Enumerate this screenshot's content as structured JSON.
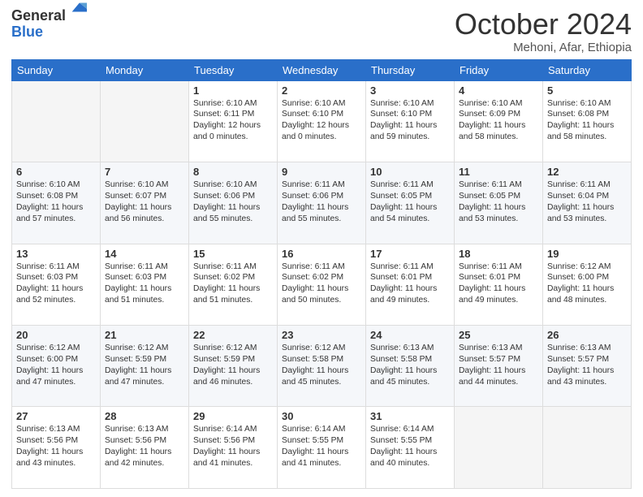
{
  "header": {
    "logo_general": "General",
    "logo_blue": "Blue",
    "month_title": "October 2024",
    "location": "Mehoni, Afar, Ethiopia"
  },
  "days_of_week": [
    "Sunday",
    "Monday",
    "Tuesday",
    "Wednesday",
    "Thursday",
    "Friday",
    "Saturday"
  ],
  "weeks": [
    [
      {
        "day": "",
        "info": ""
      },
      {
        "day": "",
        "info": ""
      },
      {
        "day": "1",
        "info": "Sunrise: 6:10 AM\nSunset: 6:11 PM\nDaylight: 12 hours\nand 0 minutes."
      },
      {
        "day": "2",
        "info": "Sunrise: 6:10 AM\nSunset: 6:10 PM\nDaylight: 12 hours\nand 0 minutes."
      },
      {
        "day": "3",
        "info": "Sunrise: 6:10 AM\nSunset: 6:10 PM\nDaylight: 11 hours\nand 59 minutes."
      },
      {
        "day": "4",
        "info": "Sunrise: 6:10 AM\nSunset: 6:09 PM\nDaylight: 11 hours\nand 58 minutes."
      },
      {
        "day": "5",
        "info": "Sunrise: 6:10 AM\nSunset: 6:08 PM\nDaylight: 11 hours\nand 58 minutes."
      }
    ],
    [
      {
        "day": "6",
        "info": "Sunrise: 6:10 AM\nSunset: 6:08 PM\nDaylight: 11 hours\nand 57 minutes."
      },
      {
        "day": "7",
        "info": "Sunrise: 6:10 AM\nSunset: 6:07 PM\nDaylight: 11 hours\nand 56 minutes."
      },
      {
        "day": "8",
        "info": "Sunrise: 6:10 AM\nSunset: 6:06 PM\nDaylight: 11 hours\nand 55 minutes."
      },
      {
        "day": "9",
        "info": "Sunrise: 6:11 AM\nSunset: 6:06 PM\nDaylight: 11 hours\nand 55 minutes."
      },
      {
        "day": "10",
        "info": "Sunrise: 6:11 AM\nSunset: 6:05 PM\nDaylight: 11 hours\nand 54 minutes."
      },
      {
        "day": "11",
        "info": "Sunrise: 6:11 AM\nSunset: 6:05 PM\nDaylight: 11 hours\nand 53 minutes."
      },
      {
        "day": "12",
        "info": "Sunrise: 6:11 AM\nSunset: 6:04 PM\nDaylight: 11 hours\nand 53 minutes."
      }
    ],
    [
      {
        "day": "13",
        "info": "Sunrise: 6:11 AM\nSunset: 6:03 PM\nDaylight: 11 hours\nand 52 minutes."
      },
      {
        "day": "14",
        "info": "Sunrise: 6:11 AM\nSunset: 6:03 PM\nDaylight: 11 hours\nand 51 minutes."
      },
      {
        "day": "15",
        "info": "Sunrise: 6:11 AM\nSunset: 6:02 PM\nDaylight: 11 hours\nand 51 minutes."
      },
      {
        "day": "16",
        "info": "Sunrise: 6:11 AM\nSunset: 6:02 PM\nDaylight: 11 hours\nand 50 minutes."
      },
      {
        "day": "17",
        "info": "Sunrise: 6:11 AM\nSunset: 6:01 PM\nDaylight: 11 hours\nand 49 minutes."
      },
      {
        "day": "18",
        "info": "Sunrise: 6:11 AM\nSunset: 6:01 PM\nDaylight: 11 hours\nand 49 minutes."
      },
      {
        "day": "19",
        "info": "Sunrise: 6:12 AM\nSunset: 6:00 PM\nDaylight: 11 hours\nand 48 minutes."
      }
    ],
    [
      {
        "day": "20",
        "info": "Sunrise: 6:12 AM\nSunset: 6:00 PM\nDaylight: 11 hours\nand 47 minutes."
      },
      {
        "day": "21",
        "info": "Sunrise: 6:12 AM\nSunset: 5:59 PM\nDaylight: 11 hours\nand 47 minutes."
      },
      {
        "day": "22",
        "info": "Sunrise: 6:12 AM\nSunset: 5:59 PM\nDaylight: 11 hours\nand 46 minutes."
      },
      {
        "day": "23",
        "info": "Sunrise: 6:12 AM\nSunset: 5:58 PM\nDaylight: 11 hours\nand 45 minutes."
      },
      {
        "day": "24",
        "info": "Sunrise: 6:13 AM\nSunset: 5:58 PM\nDaylight: 11 hours\nand 45 minutes."
      },
      {
        "day": "25",
        "info": "Sunrise: 6:13 AM\nSunset: 5:57 PM\nDaylight: 11 hours\nand 44 minutes."
      },
      {
        "day": "26",
        "info": "Sunrise: 6:13 AM\nSunset: 5:57 PM\nDaylight: 11 hours\nand 43 minutes."
      }
    ],
    [
      {
        "day": "27",
        "info": "Sunrise: 6:13 AM\nSunset: 5:56 PM\nDaylight: 11 hours\nand 43 minutes."
      },
      {
        "day": "28",
        "info": "Sunrise: 6:13 AM\nSunset: 5:56 PM\nDaylight: 11 hours\nand 42 minutes."
      },
      {
        "day": "29",
        "info": "Sunrise: 6:14 AM\nSunset: 5:56 PM\nDaylight: 11 hours\nand 41 minutes."
      },
      {
        "day": "30",
        "info": "Sunrise: 6:14 AM\nSunset: 5:55 PM\nDaylight: 11 hours\nand 41 minutes."
      },
      {
        "day": "31",
        "info": "Sunrise: 6:14 AM\nSunset: 5:55 PM\nDaylight: 11 hours\nand 40 minutes."
      },
      {
        "day": "",
        "info": ""
      },
      {
        "day": "",
        "info": ""
      }
    ]
  ]
}
